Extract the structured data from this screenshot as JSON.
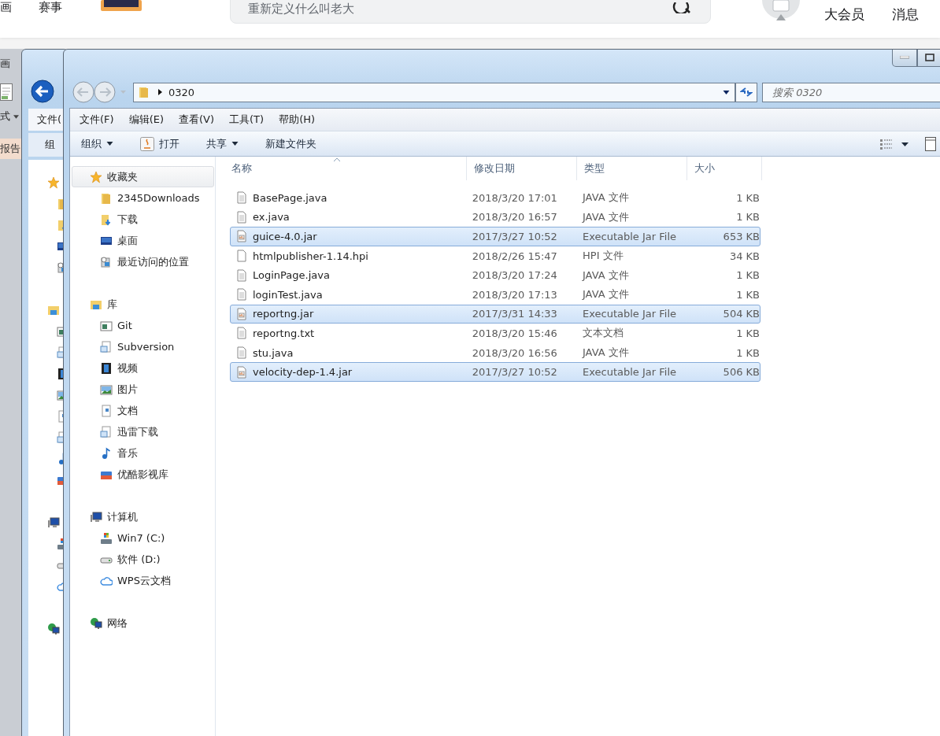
{
  "browser_header": {
    "nav_items": [
      "画",
      "赛事"
    ],
    "search": {
      "placeholder": "重新定义什么叫老大"
    },
    "links": [
      "大会员",
      "消息"
    ]
  },
  "background_app": {
    "top_label": "画",
    "menu_label": "式",
    "tab_label": "报告"
  },
  "back_window": {
    "menu_label": "文件(",
    "toolbar_label": "组"
  },
  "window": {
    "address": {
      "path": "0320"
    },
    "search": {
      "placeholder": "搜索 0320"
    },
    "menu": [
      "文件(F)",
      "编辑(E)",
      "查看(V)",
      "工具(T)",
      "帮助(H)"
    ],
    "toolbar": [
      {
        "label": "组织",
        "kind": "dropdown"
      },
      {
        "label": "打开",
        "kind": "icon"
      },
      {
        "label": "共享",
        "kind": "dropdown"
      },
      {
        "label": "新建文件夹",
        "kind": "plain"
      }
    ],
    "sidebar": [
      {
        "label": "收藏夹",
        "kind": "star",
        "selected": true,
        "children": [
          {
            "label": "2345Downloads",
            "kind": "folder",
            "selected": false
          },
          {
            "label": "下载",
            "kind": "download",
            "selected": false
          },
          {
            "label": "桌面",
            "kind": "desktop",
            "selected": false
          },
          {
            "label": "最近访问的位置",
            "kind": "recent",
            "selected": false
          }
        ]
      },
      {
        "label": "库",
        "kind": "library",
        "selected": false,
        "children": [
          {
            "label": "Git",
            "kind": "window",
            "selected": false
          },
          {
            "label": "Subversion",
            "kind": "doc",
            "selected": false
          },
          {
            "label": "视频",
            "kind": "video",
            "selected": false
          },
          {
            "label": "图片",
            "kind": "picture",
            "selected": false
          },
          {
            "label": "文档",
            "kind": "page",
            "selected": false
          },
          {
            "label": "迅雷下载",
            "kind": "doc",
            "selected": false
          },
          {
            "label": "音乐",
            "kind": "music",
            "selected": false
          },
          {
            "label": "优酷影视库",
            "kind": "bluefolder",
            "selected": false
          }
        ]
      },
      {
        "label": "计算机",
        "kind": "computer",
        "selected": false,
        "children": [
          {
            "label": "Win7 (C:)",
            "kind": "systemdrive",
            "selected": false
          },
          {
            "label": "软件 (D:)",
            "kind": "drive",
            "selected": false
          },
          {
            "label": "WPS云文档",
            "kind": "cloud",
            "selected": false
          }
        ]
      },
      {
        "label": "网络",
        "kind": "network",
        "selected": false
      }
    ],
    "table": {
      "columns": [
        "名称",
        "修改日期",
        "类型",
        "大小"
      ],
      "rows": [
        {
          "name": "BasePage.java",
          "modified": "2018/3/20 17:01",
          "type": "JAVA 文件",
          "size": "1 KB",
          "kind": "text",
          "selected": false
        },
        {
          "name": "ex.java",
          "modified": "2018/3/20 16:57",
          "type": "JAVA 文件",
          "size": "1 KB",
          "kind": "text",
          "selected": false
        },
        {
          "name": "guice-4.0.jar",
          "modified": "2017/3/27 10:52",
          "type": "Executable Jar File",
          "size": "653 KB",
          "kind": "jar",
          "selected": true
        },
        {
          "name": "htmlpublisher-1.14.hpi",
          "modified": "2018/2/26 15:47",
          "type": "HPI 文件",
          "size": "34 KB",
          "kind": "blank",
          "selected": false
        },
        {
          "name": "LoginPage.java",
          "modified": "2018/3/20 17:24",
          "type": "JAVA 文件",
          "size": "1 KB",
          "kind": "text",
          "selected": false
        },
        {
          "name": "loginTest.java",
          "modified": "2018/3/20 17:13",
          "type": "JAVA 文件",
          "size": "1 KB",
          "kind": "text",
          "selected": false
        },
        {
          "name": "reportng.jar",
          "modified": "2017/3/31 14:33",
          "type": "Executable Jar File",
          "size": "504 KB",
          "kind": "jar",
          "selected": true
        },
        {
          "name": "reportng.txt",
          "modified": "2018/3/20 15:46",
          "type": "文本文档",
          "size": "1 KB",
          "kind": "text",
          "selected": false
        },
        {
          "name": "stu.java",
          "modified": "2018/3/20 16:56",
          "type": "JAVA 文件",
          "size": "1 KB",
          "kind": "text",
          "selected": false
        },
        {
          "name": "velocity-dep-1.4.jar",
          "modified": "2017/3/27 10:52",
          "type": "Executable Jar File",
          "size": "506 KB",
          "kind": "jar",
          "selected": true
        }
      ]
    }
  }
}
